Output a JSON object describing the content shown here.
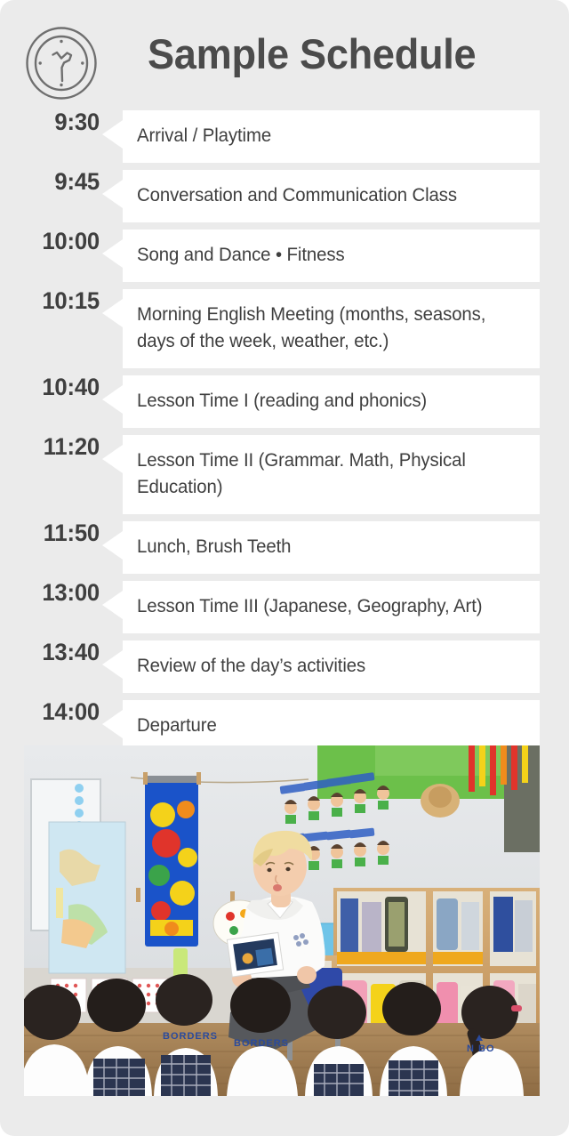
{
  "header": {
    "title": "Sample Schedule",
    "icon": "clock-icon"
  },
  "schedule": {
    "rows": [
      {
        "time": "9:30",
        "activity": "Arrival / Playtime"
      },
      {
        "time": "9:45",
        "activity": "Conversation and Communication Class"
      },
      {
        "time": "10:00",
        "activity": "Song and Dance • Fitness"
      },
      {
        "time": "10:15",
        "activity": "Morning English Meeting (months, seasons, days of the week, weather, etc.)"
      },
      {
        "time": "10:40",
        "activity": "Lesson Time I (reading and phonics)"
      },
      {
        "time": "11:20",
        "activity": "Lesson Time II (Grammar. Math, Physical Education)"
      },
      {
        "time": "11:50",
        "activity": "Lunch, Brush Teeth"
      },
      {
        "time": "13:00",
        "activity": "Lesson Time III (Japanese, Geography, Art)"
      },
      {
        "time": "13:40",
        "activity": "Review of the day’s activities"
      },
      {
        "time": "14:00",
        "activity": "Departure"
      }
    ]
  },
  "photo": {
    "alt": "Teacher holding a picture card in front of kindergarten students seated on a wooden floor in a classroom",
    "shirt_text": "NO BORDERS"
  },
  "colors": {
    "card_background": "#ebebeb",
    "row_background": "#ffffff",
    "text": "#3f3f3f",
    "title": "#4b4b4b",
    "icon_stroke": "#6f6f6f"
  }
}
